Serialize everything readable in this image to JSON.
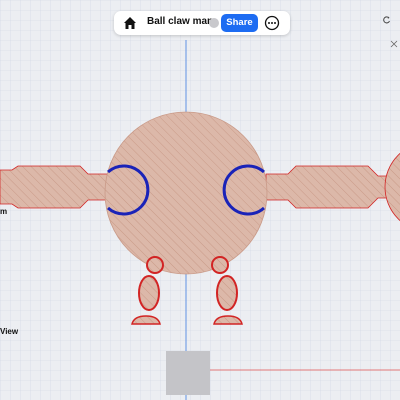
{
  "app": {
    "document_title": "Ball claw man",
    "share_label": "Share",
    "left_labels": {
      "partial_label_1": "m",
      "partial_label_2": "View"
    }
  },
  "icons": {
    "home": "home-icon",
    "chevron": "chevron-down-icon",
    "more": "more-options-icon",
    "refresh": "rotate-icon"
  },
  "colors": {
    "canvas_bg": "#eceef2",
    "grid_line": "#cfd5e3",
    "part_fill": "#dcb8a9",
    "part_hatch": "#c99a88",
    "outline_red": "#d22424",
    "outline_blue": "#1a23b8",
    "guide_blue": "#3c7be0",
    "share_button": "#1d6cf2"
  }
}
